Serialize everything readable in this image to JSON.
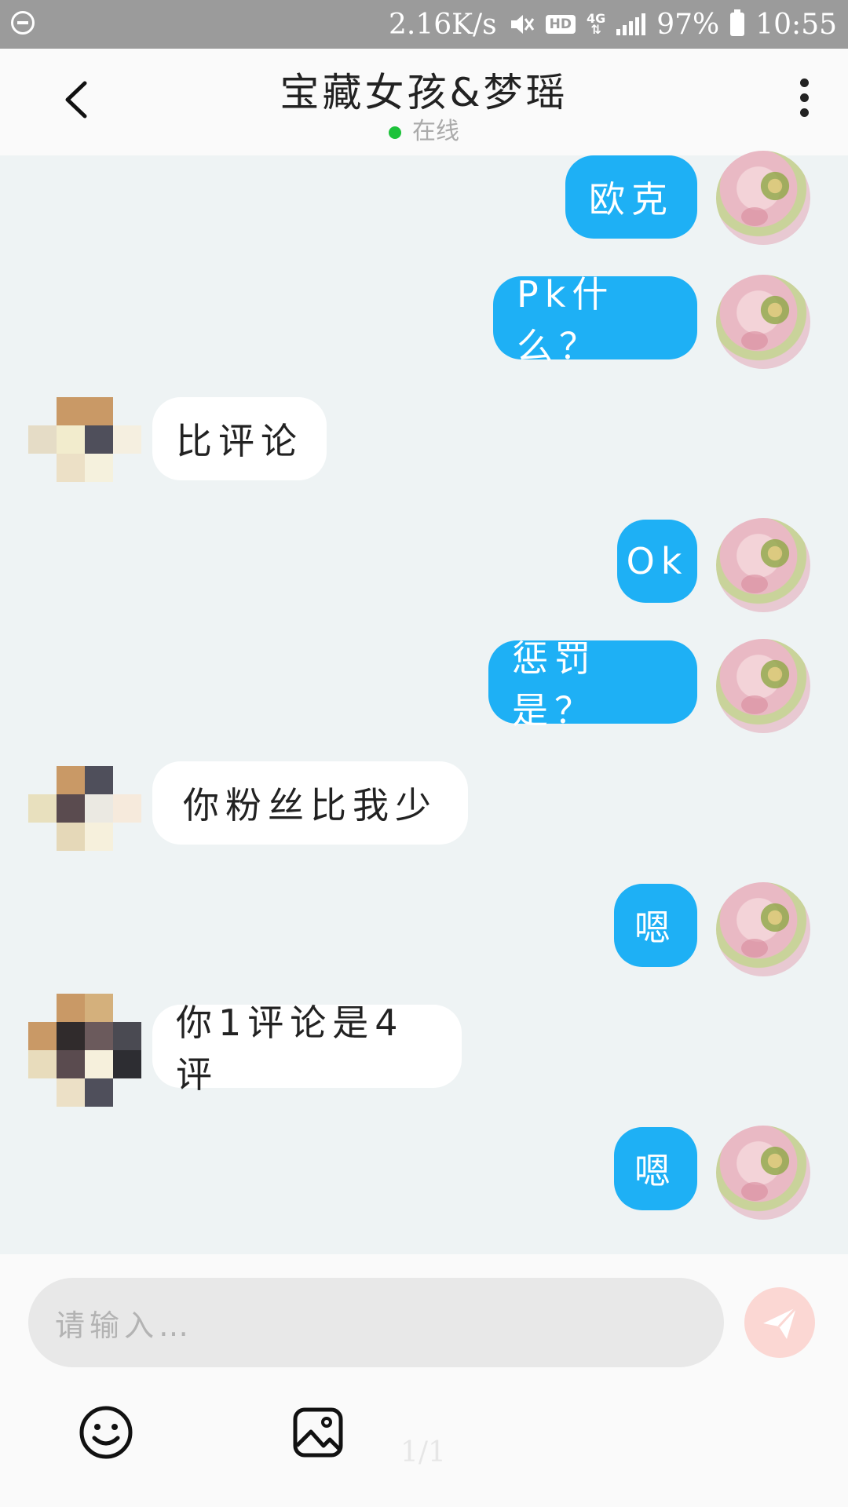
{
  "status_bar": {
    "speed": "2.16K/s",
    "hd_badge": "HD",
    "network": "4G",
    "battery": "97%",
    "time": "10:55"
  },
  "header": {
    "title": "宝藏女孩&梦瑶",
    "status": "在线"
  },
  "messages": [
    {
      "side": "me",
      "text": "欧克"
    },
    {
      "side": "me",
      "text": "Pk什么？"
    },
    {
      "side": "them",
      "text": "比评论"
    },
    {
      "side": "me",
      "text": "Ok"
    },
    {
      "side": "me",
      "text": "惩罚是？"
    },
    {
      "side": "them",
      "text": "你粉丝比我少"
    },
    {
      "side": "me",
      "text": "嗯"
    },
    {
      "side": "them",
      "text": "你1评论是4评"
    },
    {
      "side": "me",
      "text": "嗯"
    }
  ],
  "input": {
    "placeholder": "请输入…"
  },
  "page_indicator": "1/1",
  "icons": {
    "back": "chevron-left-icon",
    "more": "more-vertical-icon",
    "send": "send-icon",
    "emoji": "emoji-icon",
    "image": "image-icon"
  },
  "colors": {
    "my_bubble": "#1eb0f5",
    "their_bubble": "#ffffff",
    "online_dot": "#1dc23a",
    "send_button": "#fbd7d3"
  }
}
